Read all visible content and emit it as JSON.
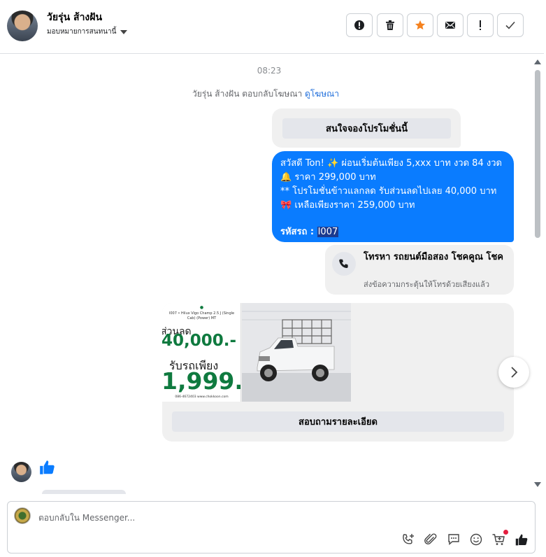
{
  "header": {
    "contact_name": "วัยรุ่น ส้างฝัน",
    "assignee": "มอบหมายการสนทนานี้",
    "actions": [
      "report-icon",
      "trash-icon",
      "star-icon",
      "mail-icon",
      "exclamation-icon",
      "check-icon"
    ],
    "colors": {
      "star": "#f5821f"
    }
  },
  "chat": {
    "time": "08:23",
    "reply_note": "วัยรุ่น ส้างฝัน ตอบกลับโฆษณา",
    "view_ad_link": "ดูโฆษณา",
    "interest_button": "สนใจจองโปรโมชั่นนี้",
    "message": {
      "line1": "สวัสดี Ton! ✨  ผ่อนเริ่มต้นเพียง 5,xxx บาท งวด 84 งวด",
      "line2": "🔔 ราคา 299,000 บาท",
      "line3": "** โปรโมชั่นข้าวแลกลด รับส่วนลดไปเลย 40,000 บาท",
      "line4": "🎀  เหลือเพียงราคา 259,000 บาท",
      "code_label": "รหัสรถ : ",
      "code_value": "I007",
      "color": "#0a7cff"
    },
    "call_card": {
      "title": "โทรหา รถยนต์มือสอง โชคคูณ โชค",
      "subtitle": "ส่งข้อความกระตุ้นให้โทรด้วยเสียงแล้ว"
    },
    "carousel": {
      "promo_top": "I007 • Hilux Vigo Champ 2.5 J (Single Cab) (Power) MT",
      "discount_label": "ส่วนลด",
      "discount_value": "40,000.-",
      "down_label": "รับรถเพียง",
      "down_value": "1,999.-",
      "promo_footer": "086-4672403 www.chokkoon.com",
      "detail_button": "สอบถามรายละเอียด"
    }
  },
  "composer": {
    "placeholder": "ตอบกลับใน Messenger...",
    "tools": [
      "call-plus-icon",
      "attach-icon",
      "quick-reply-icon",
      "emoji-icon",
      "cart-icon",
      "like-icon"
    ]
  }
}
